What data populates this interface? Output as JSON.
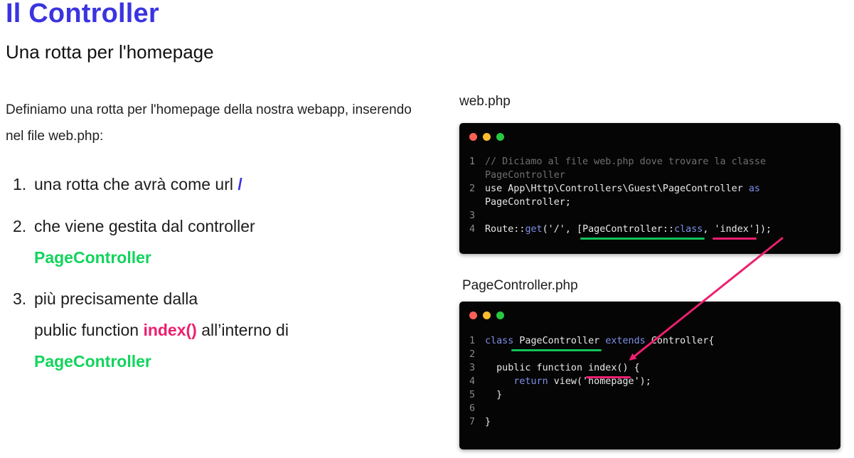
{
  "heading": {
    "title": "Il Controller",
    "subtitle": "Una rotta per l'homepage"
  },
  "intro": "Definiamo una rotta per l'homepage della nostra webapp, inserendo nel file web.php:",
  "steps": [
    {
      "num": "1.",
      "text": "una rotta che avrà come url ",
      "url": "/"
    },
    {
      "num": "2.",
      "text": "che viene gestita dal controller",
      "controller": "PageController"
    },
    {
      "num": "3.",
      "text": "più precisamente dalla",
      "line2_prefix": "public function ",
      "method": "index()",
      "line2_suffix": " all’interno di",
      "controller": "PageController"
    }
  ],
  "colors": {
    "accent": "#3a34e0",
    "green": "#12d45d",
    "pink": "#ec1f6e",
    "dot_red": "#ff5f57",
    "dot_yellow": "#febc2e",
    "dot_green": "#28c840"
  },
  "web_php": {
    "label": "web.php",
    "line1": {
      "n": "1",
      "text": "// Diciamo al file web.php dove trovare la classe",
      "cont": "PageController"
    },
    "line2": {
      "n": "2",
      "use": "use",
      "path": " App\\Http\\Controllers\\Guest\\PageController ",
      "as": "as",
      "cont": "PageController;"
    },
    "line3": {
      "n": "3"
    },
    "line4": {
      "n": "4",
      "route": "Route::",
      "get": "get",
      "args1": "('/', [",
      "cls": "PageController::",
      "clskw": "class",
      "comma": ", ",
      "method": "'index'",
      "end": "]);"
    }
  },
  "page_controller_php": {
    "label": "PageController.php",
    "line1": {
      "n": "1",
      "class": "class",
      "name": " PageController",
      "extends": "extends",
      "rest": " Controller{"
    },
    "line2": {
      "n": "2"
    },
    "line3": {
      "n": "3",
      "prefix": "  public function ",
      "method": "index()",
      "suffix": " {"
    },
    "line4": {
      "n": "4",
      "ret": "return",
      "rest": " view('homepage');"
    },
    "line5": {
      "n": "5",
      "text": "  }"
    },
    "line6": {
      "n": "6"
    },
    "line7": {
      "n": "7",
      "text": "}"
    }
  }
}
